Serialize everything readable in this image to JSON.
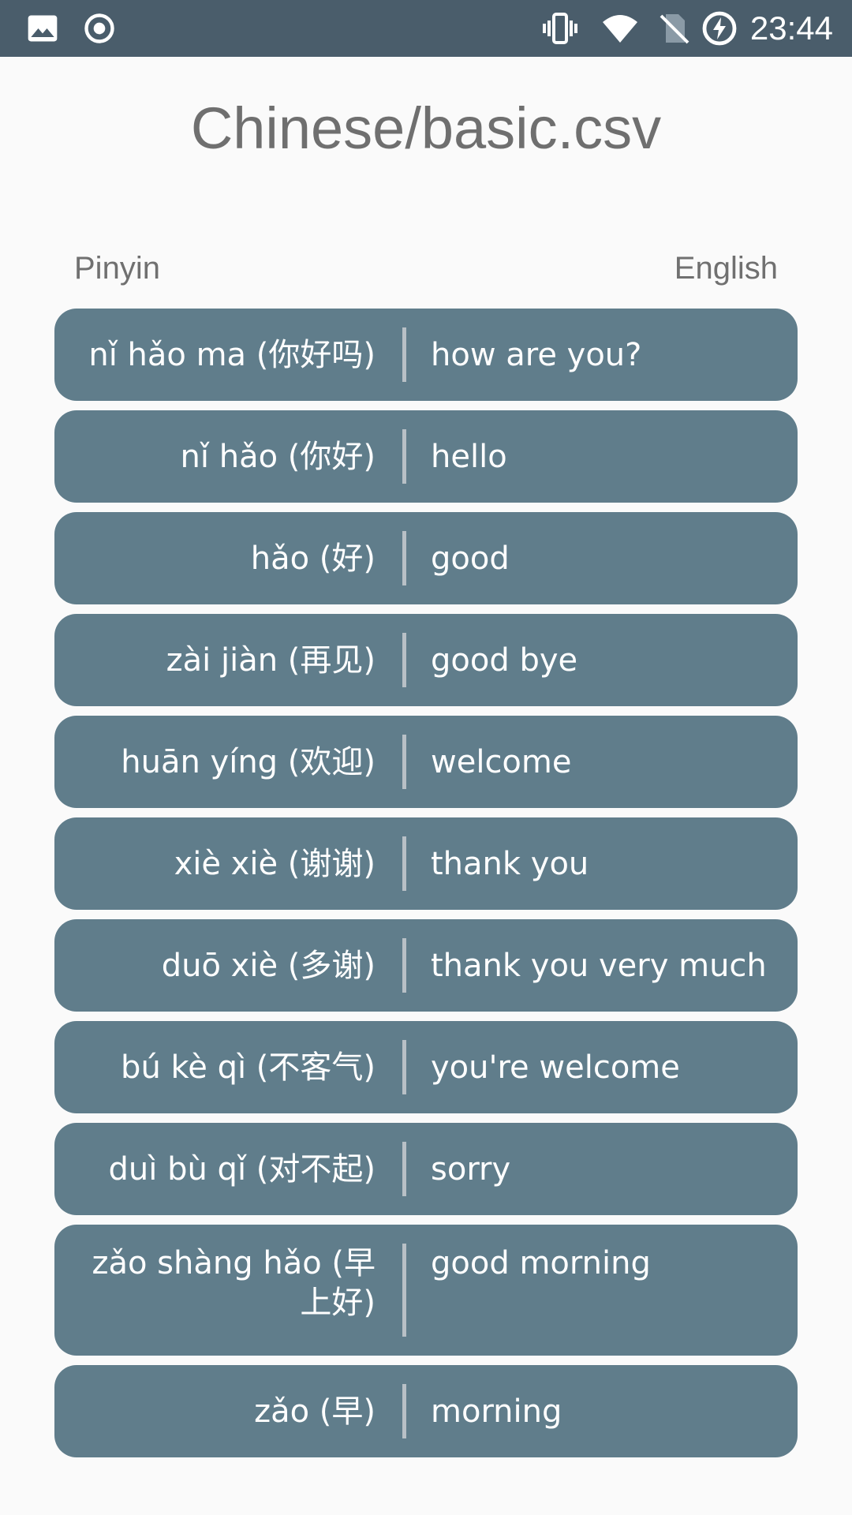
{
  "status_bar": {
    "time": "23:44",
    "left_icons": [
      "image-icon",
      "record-icon"
    ],
    "right_icons": [
      "vibrate-icon",
      "wifi-icon",
      "no-sim-icon",
      "battery-charging-icon"
    ]
  },
  "title": "Chinese/basic.csv",
  "columns": {
    "left": "Pinyin",
    "right": "English"
  },
  "rows": [
    {
      "pinyin": "nǐ hǎo ma (你好吗)",
      "english": "how are you?"
    },
    {
      "pinyin": "nǐ hǎo (你好)",
      "english": "hello"
    },
    {
      "pinyin": "hǎo (好)",
      "english": "good"
    },
    {
      "pinyin": "zài jiàn (再见)",
      "english": "good bye"
    },
    {
      "pinyin": "huān yíng (欢迎)",
      "english": "welcome"
    },
    {
      "pinyin": "xiè xiè (谢谢)",
      "english": "thank you"
    },
    {
      "pinyin": "duō xiè (多谢)",
      "english": "thank you very much"
    },
    {
      "pinyin": "bú kè qì (不客气)",
      "english": "you're welcome"
    },
    {
      "pinyin": "duì bù qǐ (对不起)",
      "english": "sorry"
    },
    {
      "pinyin": "zǎo shàng hǎo (早上好)",
      "english": "good morning"
    },
    {
      "pinyin": "zǎo (早)",
      "english": "morning"
    }
  ],
  "colors": {
    "status_bar": "#4a5d6b",
    "row_background": "#607d8b",
    "background": "#fafafa",
    "divider": "#b8c0c6"
  }
}
